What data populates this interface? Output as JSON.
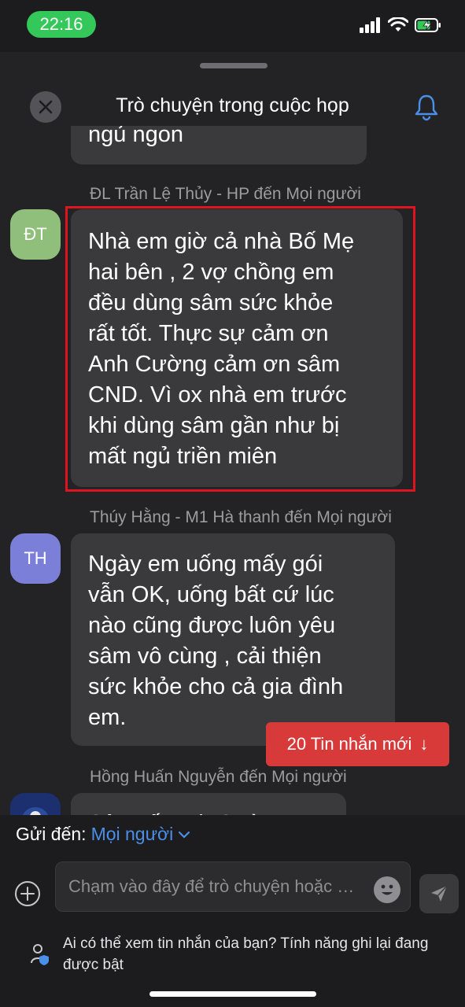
{
  "status_bar": {
    "time": "22:16"
  },
  "header": {
    "title": "Trò chuyện trong cuộc họp"
  },
  "messages": [
    {
      "partial_text": "ngủ ngon"
    },
    {
      "sender_line": "ĐL Trần Lệ Thủy - HP đến Mọi người",
      "avatar_initials": "ĐT",
      "avatar_color": "#8fbf7a",
      "text": "Nhà em giờ cả nhà Bố Mẹ\nhai bên , 2 vợ chồng em\nđều dùng sâm sức khỏe\nrất tốt. Thực sự cảm ơn\nAnh Cường cảm ơn sâm\nCND. Vì ox nhà em trước\nkhi dùng sâm gần như bị\nmất ngủ triền miên",
      "highlighted": true
    },
    {
      "sender_line": "Thúy Hằng - M1 Hà thanh đến Mọi người",
      "avatar_initials": "TH",
      "avatar_color": "#7b7fd8",
      "text": "Ngày em uống mấy gói\nvẫn OK, uống bất cứ lúc\nnào cũng được luôn yêu\nsâm vô cùng , cải thiện\nsức khỏe cho cả gia đình\nem."
    },
    {
      "sender_line": "Hồng Huấn Nguyễn đến Mọi người",
      "partial_text": "Sâm tốt anh Cường"
    }
  ],
  "new_messages_button": {
    "label": "20 Tin nhắn mới",
    "arrow": "↓"
  },
  "compose": {
    "send_to_label": "Gửi đến:",
    "recipient": "Mọi người",
    "placeholder": "Chạm vào đây để trò chuyện hoặc chia sẻ"
  },
  "notice": "Ai có thể xem tin nhắn của bạn? Tính năng ghi lại đang được bật",
  "colors": {
    "accent": "#4a8fe8",
    "highlight": "#e0141e",
    "new_msg_bg": "#d83a3a",
    "time_pill": "#34c759"
  }
}
